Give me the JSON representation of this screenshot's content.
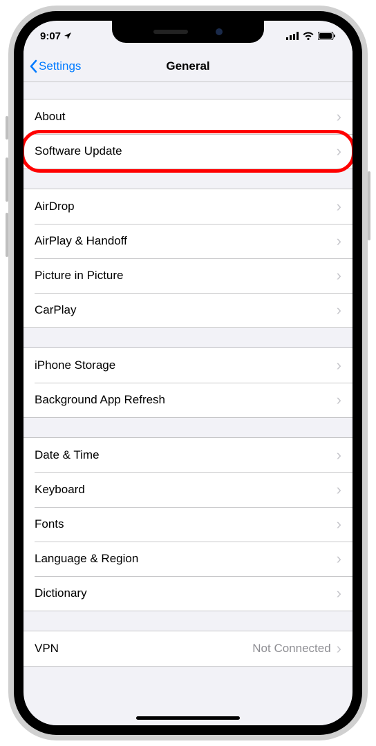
{
  "status": {
    "time": "9:07",
    "loc_icon": "location-icon"
  },
  "nav": {
    "back": "Settings",
    "title": "General"
  },
  "groups": [
    {
      "rows": [
        {
          "label": "About"
        },
        {
          "label": "Software Update",
          "highlight": true
        }
      ]
    },
    {
      "rows": [
        {
          "label": "AirDrop"
        },
        {
          "label": "AirPlay & Handoff"
        },
        {
          "label": "Picture in Picture"
        },
        {
          "label": "CarPlay"
        }
      ]
    },
    {
      "rows": [
        {
          "label": "iPhone Storage"
        },
        {
          "label": "Background App Refresh"
        }
      ]
    },
    {
      "rows": [
        {
          "label": "Date & Time"
        },
        {
          "label": "Keyboard"
        },
        {
          "label": "Fonts"
        },
        {
          "label": "Language & Region"
        },
        {
          "label": "Dictionary"
        }
      ]
    },
    {
      "rows": [
        {
          "label": "VPN",
          "value": "Not Connected"
        }
      ]
    }
  ]
}
